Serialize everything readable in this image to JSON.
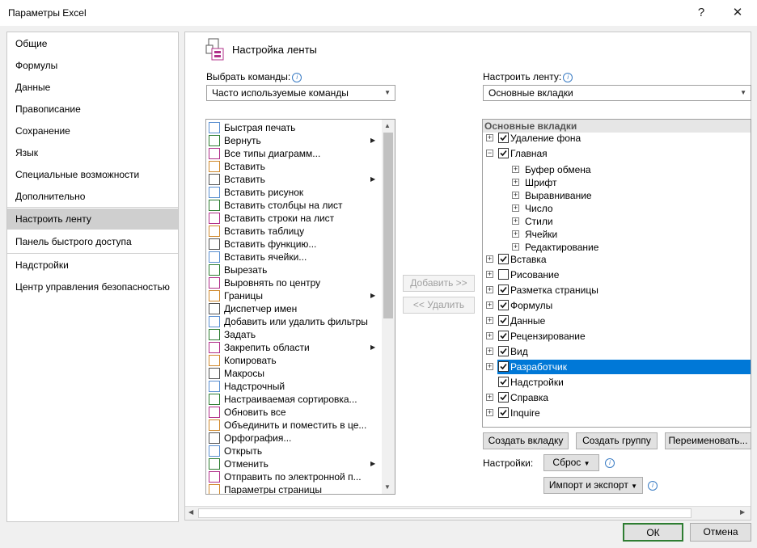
{
  "window": {
    "title": "Параметры Excel",
    "help": "?",
    "close": "✕"
  },
  "nav": {
    "items": [
      {
        "label": "Общие"
      },
      {
        "label": "Формулы"
      },
      {
        "label": "Данные"
      },
      {
        "label": "Правописание"
      },
      {
        "label": "Сохранение"
      },
      {
        "label": "Язык"
      },
      {
        "label": "Специальные возможности"
      },
      {
        "label": "Дополнительно"
      },
      {
        "label": "Настроить ленту",
        "selected": true
      },
      {
        "label": "Панель быстрого доступа"
      },
      {
        "label": "Надстройки"
      },
      {
        "label": "Центр управления безопасностью"
      }
    ]
  },
  "header": {
    "title": "Настройка ленты",
    "icon": "customize-ribbon-icon"
  },
  "left": {
    "label": "Выбрать команды:",
    "combo_value": "Часто используемые команды",
    "commands": [
      {
        "label": "Быстрая печать",
        "icon": "quick-print-icon"
      },
      {
        "label": "Вернуть",
        "icon": "redo-icon",
        "submenu": true
      },
      {
        "label": "Все типы диаграмм...",
        "icon": "chart-icon"
      },
      {
        "label": "Вставить",
        "icon": "paste-icon"
      },
      {
        "label": "Вставить",
        "icon": "paste-icon",
        "submenu": true
      },
      {
        "label": "Вставить рисунок",
        "icon": "picture-icon"
      },
      {
        "label": "Вставить столбцы на лист",
        "icon": "insert-columns-icon"
      },
      {
        "label": "Вставить строки на лист",
        "icon": "insert-rows-icon"
      },
      {
        "label": "Вставить таблицу",
        "icon": "table-icon"
      },
      {
        "label": "Вставить функцию...",
        "icon": "function-icon"
      },
      {
        "label": "Вставить ячейки...",
        "icon": "insert-cells-icon"
      },
      {
        "label": "Вырезать",
        "icon": "scissors-icon"
      },
      {
        "label": "Выровнять по центру",
        "icon": "align-center-icon"
      },
      {
        "label": "Границы",
        "icon": "borders-icon",
        "submenu": true
      },
      {
        "label": "Диспетчер имен",
        "icon": "name-manager-icon"
      },
      {
        "label": "Добавить или удалить фильтры",
        "icon": "filter-icon"
      },
      {
        "label": "Задать",
        "icon": "define-icon"
      },
      {
        "label": "Закрепить области",
        "icon": "freeze-panes-icon",
        "submenu": true
      },
      {
        "label": "Копировать",
        "icon": "copy-icon"
      },
      {
        "label": "Макросы",
        "icon": "macro-icon"
      },
      {
        "label": "Надстрочный",
        "icon": "superscript-icon"
      },
      {
        "label": "Настраиваемая сортировка...",
        "icon": "sort-icon"
      },
      {
        "label": "Обновить все",
        "icon": "refresh-icon"
      },
      {
        "label": "Объединить и поместить в це...",
        "icon": "merge-icon"
      },
      {
        "label": "Орфография...",
        "icon": "spelling-icon"
      },
      {
        "label": "Открыть",
        "icon": "open-folder-icon"
      },
      {
        "label": "Отменить",
        "icon": "undo-icon",
        "submenu": true
      },
      {
        "label": "Отправить по электронной п...",
        "icon": "email-icon"
      },
      {
        "label": "Параметры страницы",
        "icon": "page-setup-icon"
      }
    ]
  },
  "middle": {
    "add": "Добавить >>",
    "remove": "<< Удалить"
  },
  "right": {
    "label": "Настроить ленту:",
    "combo_value": "Основные вкладки",
    "tree_header": "Основные вкладки",
    "tree": [
      {
        "label": "Удаление фона",
        "checked": true,
        "expander": "+",
        "level": 0
      },
      {
        "label": "Главная",
        "checked": true,
        "expander": "−",
        "level": 0
      },
      {
        "label": "Буфер обмена",
        "expander": "+",
        "level": 1
      },
      {
        "label": "Шрифт",
        "expander": "+",
        "level": 1
      },
      {
        "label": "Выравнивание",
        "expander": "+",
        "level": 1
      },
      {
        "label": "Число",
        "expander": "+",
        "level": 1
      },
      {
        "label": "Стили",
        "expander": "+",
        "level": 1
      },
      {
        "label": "Ячейки",
        "expander": "+",
        "level": 1
      },
      {
        "label": "Редактирование",
        "expander": "+",
        "level": 1
      },
      {
        "label": "Вставка",
        "checked": true,
        "expander": "+",
        "level": 0
      },
      {
        "label": "Рисование",
        "checked": false,
        "expander": "+",
        "level": 0
      },
      {
        "label": "Разметка страницы",
        "checked": true,
        "expander": "+",
        "level": 0
      },
      {
        "label": "Формулы",
        "checked": true,
        "expander": "+",
        "level": 0
      },
      {
        "label": "Данные",
        "checked": true,
        "expander": "+",
        "level": 0
      },
      {
        "label": "Рецензирование",
        "checked": true,
        "expander": "+",
        "level": 0
      },
      {
        "label": "Вид",
        "checked": true,
        "expander": "+",
        "level": 0
      },
      {
        "label": "Разработчик",
        "checked": true,
        "expander": "+",
        "level": 0,
        "selected": true
      },
      {
        "label": "Надстройки",
        "checked": true,
        "expander": "",
        "level": 0
      },
      {
        "label": "Справка",
        "checked": true,
        "expander": "+",
        "level": 0
      },
      {
        "label": "Inquire",
        "checked": true,
        "expander": "+",
        "level": 0
      }
    ],
    "buttons": {
      "new_tab": "Создать вкладку",
      "new_group": "Создать группу",
      "rename": "Переименовать..."
    },
    "settings_label": "Настройки:",
    "reset": "Сброс",
    "import_export": "Импорт и экспорт"
  },
  "footer": {
    "ok": "ОК",
    "cancel": "Отмена"
  },
  "colors": {
    "selection": "#0078d7",
    "nav_selected": "#cfcfcf",
    "ok_border": "#2e7d32"
  }
}
